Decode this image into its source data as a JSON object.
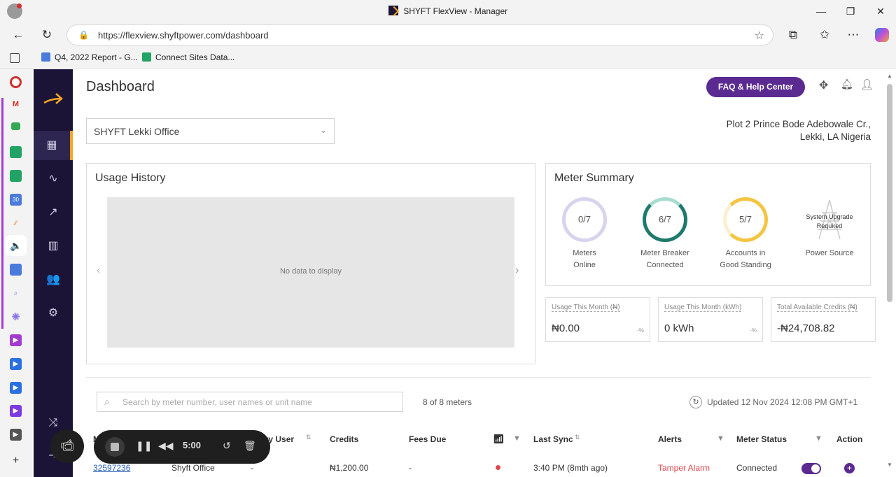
{
  "browser": {
    "window_title": "SHYFT FlexView - Manager",
    "url": "https://flexview.shyftpower.com/dashboard",
    "bookmarks": [
      {
        "label": "Q4, 2022 Report - G...",
        "color": "#4a7bdc"
      },
      {
        "label": "Connect Sites Data...",
        "color": "#21a366"
      }
    ]
  },
  "header": {
    "title": "Dashboard",
    "help_button": "FAQ & Help Center"
  },
  "site_select": {
    "value": "SHYFT Lekki Office"
  },
  "address": {
    "line1": "Plot 2 Prince Bode Adebowale Cr.,",
    "line2": "Lekki, LA Nigeria"
  },
  "usage_history": {
    "title": "Usage History",
    "empty": "No data to display"
  },
  "meter_summary": {
    "title": "Meter Summary",
    "items": [
      {
        "value": "0/7",
        "label1": "Meters",
        "label2": "Online",
        "color": "#d8d3ee"
      },
      {
        "value": "6/7",
        "label1": "Meter Breaker",
        "label2": "Connected",
        "color": "#1e7a6a"
      },
      {
        "value": "5/7",
        "label1": "Accounts in",
        "label2": "Good Standing",
        "color": "#f5c542"
      }
    ],
    "power": {
      "status1": "System Upgrade",
      "status2": "Required",
      "label": "Power Source"
    }
  },
  "stats": [
    {
      "label": "Usage This Month (₦)",
      "value": "₦0.00",
      "pct": "-%"
    },
    {
      "label": "Usage This Month (kWh)",
      "value": "0 kWh",
      "pct": "-%"
    },
    {
      "label": "Total Available Credits (₦)",
      "value": "-₦24,708.82",
      "pct": ""
    }
  ],
  "table": {
    "search_placeholder": "Search by meter number, user names or unit name",
    "count": "8 of 8 meters",
    "updated": "Updated 12 Nov 2024 12:08 PM GMT+1",
    "columns": {
      "meter": "M",
      "primary_user": "ary User",
      "credits": "Credits",
      "fees_due": "Fees Due",
      "last_sync": "Last Sync",
      "alerts": "Alerts",
      "status": "Meter Status",
      "action": "Action"
    },
    "rows": [
      {
        "meter": "32597236",
        "name": "Shyft Office",
        "user": "-",
        "credits": "₦1,200.00",
        "fees": "-",
        "last_sync": "3:40 PM  (8mth ago)",
        "alert": "Tamper Alarm",
        "status": "Connected"
      }
    ]
  },
  "recorder": {
    "timer": "5:00"
  },
  "colors": {
    "brand_dark": "#1b1437",
    "brand_accent": "#f5a623",
    "help_button_bg": "#5b2a91",
    "alert_red": "#e0474c",
    "toggle_purple": "#5b2a91"
  }
}
